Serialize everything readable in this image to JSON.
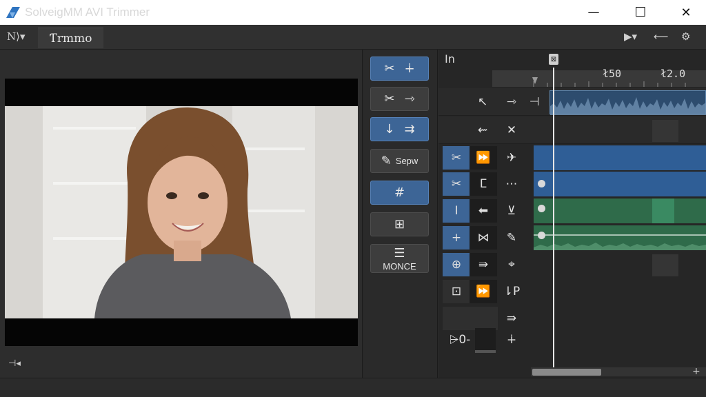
{
  "window": {
    "title": "SolveigMM AVI Trimmer",
    "minimize_glyph": "—",
    "maximize_glyph": "☐",
    "close_glyph": "✕"
  },
  "toolbar": {
    "mode_label": "N⟩▾",
    "tab_label": "Ƭrmmo"
  },
  "tools": {
    "btn_cut_1": {
      "icon_left": "✂",
      "icon_right": "∔"
    },
    "btn_cut_2": {
      "icon_left": "✂",
      "icon_right": "⇾"
    },
    "btn_split": {
      "icon_left": "↓",
      "icon_right": "⇉"
    },
    "btn_sepw": {
      "icon": "✎",
      "label": "Sepw"
    },
    "btn_grid": {
      "icon": "#"
    },
    "btn_doc": {
      "icon": "⊞"
    },
    "btn_monce": {
      "icon": "☰",
      "label": "MONCE"
    }
  },
  "timeline": {
    "in_label": "In",
    "ruler_labels": [
      "ł50",
      "ł2.0"
    ],
    "rows": [
      {
        "cells": [
          "↖",
          "⇾",
          "⊣"
        ]
      },
      {
        "cells": [
          "⇜",
          "✕"
        ]
      },
      {
        "cells": [
          "✂",
          "⏩",
          "✈"
        ]
      },
      {
        "cells": [
          "✂",
          "ⵎ",
          "⋯"
        ]
      },
      {
        "cells": [
          "I",
          "⬅",
          "⊻"
        ]
      },
      {
        "cells": [
          "+",
          "⋈",
          "✎"
        ]
      },
      {
        "cells": [
          "⊕",
          "⇛",
          "⌖"
        ]
      },
      {
        "cells": [
          "⊡",
          "⏩",
          "⇂P"
        ]
      },
      {
        "cells": [
          "",
          "",
          "⇛"
        ]
      },
      {
        "cells": [
          "⩥0-",
          "",
          "∔"
        ]
      }
    ],
    "playhead_handle": "⊠"
  },
  "preview": {
    "marker": "⊣◂"
  },
  "scrollbar": {
    "end_glyph": "+"
  },
  "colors": {
    "accent_blue": "#3d6596",
    "track_blue": "#2f5e96",
    "track_green": "#2f6b4a",
    "audio_wave": "#6d8fb0"
  }
}
